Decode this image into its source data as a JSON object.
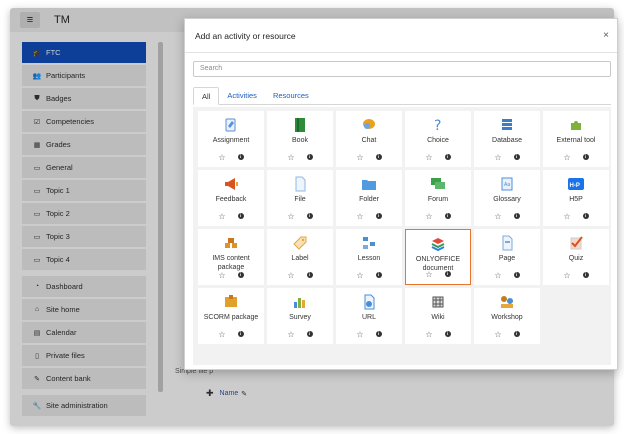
{
  "header": {
    "brand": "TM",
    "menu_glyph": "≡"
  },
  "sidebar": {
    "items": [
      {
        "label": "FTC",
        "icon": "graduation-cap-icon",
        "glyph": "🎓",
        "active": true
      },
      {
        "label": "Participants",
        "icon": "users-icon",
        "glyph": "👥"
      },
      {
        "label": "Badges",
        "icon": "shield-icon",
        "glyph": "⛊"
      },
      {
        "label": "Competencies",
        "icon": "check-square-icon",
        "glyph": "☑"
      },
      {
        "label": "Grades",
        "icon": "table-icon",
        "glyph": "▦"
      },
      {
        "label": "General",
        "icon": "folder-icon",
        "glyph": "▭"
      },
      {
        "label": "Topic 1",
        "icon": "folder-icon",
        "glyph": "▭"
      },
      {
        "label": "Topic 2",
        "icon": "folder-icon",
        "glyph": "▭"
      },
      {
        "label": "Topic 3",
        "icon": "folder-icon",
        "glyph": "▭"
      },
      {
        "label": "Topic 4",
        "icon": "folder-icon",
        "glyph": "▭"
      }
    ],
    "items2": [
      {
        "label": "Dashboard",
        "icon": "dashboard-icon",
        "glyph": "◔"
      },
      {
        "label": "Site home",
        "icon": "home-icon",
        "glyph": "⌂"
      },
      {
        "label": "Calendar",
        "icon": "calendar-icon",
        "glyph": "▤"
      },
      {
        "label": "Private files",
        "icon": "file-icon",
        "glyph": "▯"
      },
      {
        "label": "Content bank",
        "icon": "pencil-icon",
        "glyph": "✎"
      }
    ],
    "items3": [
      {
        "label": "Site administration",
        "icon": "wrench-icon",
        "glyph": "🔧"
      }
    ]
  },
  "background": {
    "name_link": "Name",
    "faded_text": "Simple file p"
  },
  "modal": {
    "title": "Add an activity or resource",
    "close_glyph": "×",
    "search_placeholder": "Search",
    "tabs": [
      {
        "label": "All",
        "active": true
      },
      {
        "label": "Activities"
      },
      {
        "label": "Resources"
      }
    ],
    "star_glyph": "☆",
    "info_glyph": "i",
    "tiles": [
      {
        "label": "Assignment",
        "icon": "assignment-icon",
        "color": "#5b8fd9"
      },
      {
        "label": "Book",
        "icon": "book-icon",
        "color": "#2e8b3a"
      },
      {
        "label": "Chat",
        "icon": "chat-icon",
        "color": "#e8a21f"
      },
      {
        "label": "Choice",
        "icon": "choice-icon",
        "color": "#4a8ed6"
      },
      {
        "label": "Database",
        "icon": "database-icon",
        "color": "#3d7cc9"
      },
      {
        "label": "External tool",
        "icon": "puzzle-icon",
        "color": "#7fb23a"
      },
      {
        "label": "Feedback",
        "icon": "megaphone-icon",
        "color": "#d9531e"
      },
      {
        "label": "File",
        "icon": "file-icon",
        "color": "#8fb8e6"
      },
      {
        "label": "Folder",
        "icon": "folder-icon",
        "color": "#4f9ae0"
      },
      {
        "label": "Forum",
        "icon": "forum-icon",
        "color": "#3aa04a"
      },
      {
        "label": "Glossary",
        "icon": "glossary-icon",
        "color": "#4f8fd8"
      },
      {
        "label": "H5P",
        "icon": "h5p-icon",
        "color": "#1a73e8"
      },
      {
        "label": "IMS content package",
        "icon": "package-icon",
        "color": "#e0912a"
      },
      {
        "label": "Label",
        "icon": "tag-icon",
        "color": "#e8a53a"
      },
      {
        "label": "Lesson",
        "icon": "lesson-icon",
        "color": "#4a8ed6"
      },
      {
        "label": "ONLYOFFICE document",
        "icon": "onlyoffice-icon",
        "color": "#3a9a55",
        "selected": true
      },
      {
        "label": "Page",
        "icon": "page-icon",
        "color": "#7fa9de"
      },
      {
        "label": "Quiz",
        "icon": "quiz-icon",
        "color": "#d9531e"
      },
      {
        "label": "SCORM package",
        "icon": "scorm-icon",
        "color": "#e0a02a"
      },
      {
        "label": "Survey",
        "icon": "survey-icon",
        "color": "#4a8ed6"
      },
      {
        "label": "URL",
        "icon": "url-icon",
        "color": "#4a8ed6"
      },
      {
        "label": "Wiki",
        "icon": "wiki-icon",
        "color": "#555555"
      },
      {
        "label": "Workshop",
        "icon": "workshop-icon",
        "color": "#c77a1f"
      }
    ]
  }
}
